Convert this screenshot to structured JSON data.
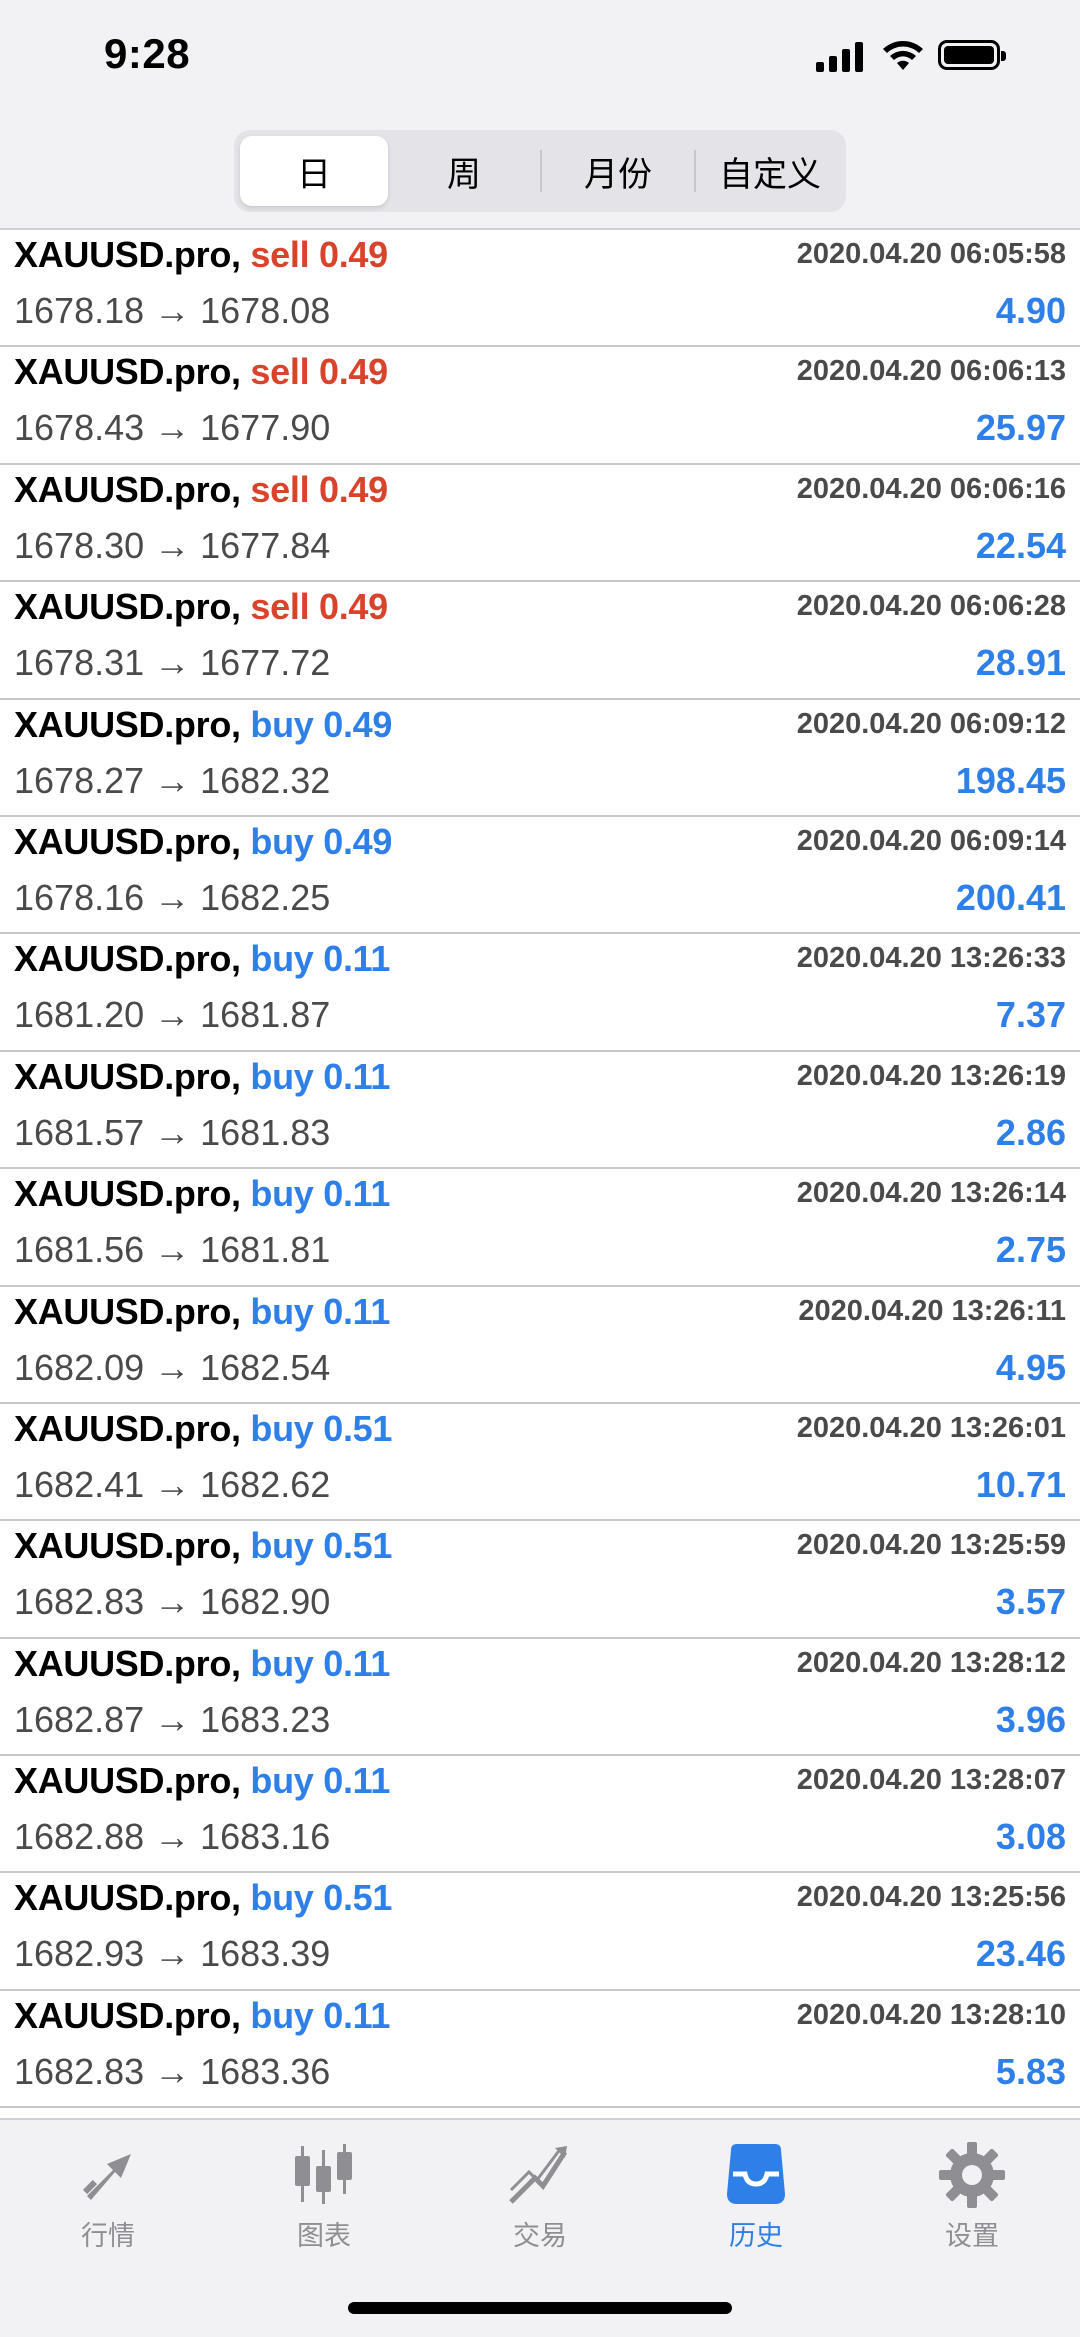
{
  "status_bar": {
    "time": "9:28"
  },
  "segmented": [
    "日",
    "周",
    "月份",
    "自定义"
  ],
  "segmented_active": 0,
  "colors": {
    "sell": "#d9432c",
    "buy": "#2f7fe8",
    "profit": "#2f7fe8"
  },
  "trades": [
    {
      "symbol": "XAUUSD.pro,",
      "side": "sell",
      "volume": "0.49",
      "time": "2020.04.20 06:05:58",
      "prices": "1678.18 → 1678.08",
      "profit": "4.90"
    },
    {
      "symbol": "XAUUSD.pro,",
      "side": "sell",
      "volume": "0.49",
      "time": "2020.04.20 06:06:13",
      "prices": "1678.43 → 1677.90",
      "profit": "25.97"
    },
    {
      "symbol": "XAUUSD.pro,",
      "side": "sell",
      "volume": "0.49",
      "time": "2020.04.20 06:06:16",
      "prices": "1678.30 → 1677.84",
      "profit": "22.54"
    },
    {
      "symbol": "XAUUSD.pro,",
      "side": "sell",
      "volume": "0.49",
      "time": "2020.04.20 06:06:28",
      "prices": "1678.31 → 1677.72",
      "profit": "28.91"
    },
    {
      "symbol": "XAUUSD.pro,",
      "side": "buy",
      "volume": "0.49",
      "time": "2020.04.20 06:09:12",
      "prices": "1678.27 → 1682.32",
      "profit": "198.45"
    },
    {
      "symbol": "XAUUSD.pro,",
      "side": "buy",
      "volume": "0.49",
      "time": "2020.04.20 06:09:14",
      "prices": "1678.16 → 1682.25",
      "profit": "200.41"
    },
    {
      "symbol": "XAUUSD.pro,",
      "side": "buy",
      "volume": "0.11",
      "time": "2020.04.20 13:26:33",
      "prices": "1681.20 → 1681.87",
      "profit": "7.37"
    },
    {
      "symbol": "XAUUSD.pro,",
      "side": "buy",
      "volume": "0.11",
      "time": "2020.04.20 13:26:19",
      "prices": "1681.57 → 1681.83",
      "profit": "2.86"
    },
    {
      "symbol": "XAUUSD.pro,",
      "side": "buy",
      "volume": "0.11",
      "time": "2020.04.20 13:26:14",
      "prices": "1681.56 → 1681.81",
      "profit": "2.75"
    },
    {
      "symbol": "XAUUSD.pro,",
      "side": "buy",
      "volume": "0.11",
      "time": "2020.04.20 13:26:11",
      "prices": "1682.09 → 1682.54",
      "profit": "4.95"
    },
    {
      "symbol": "XAUUSD.pro,",
      "side": "buy",
      "volume": "0.51",
      "time": "2020.04.20 13:26:01",
      "prices": "1682.41 → 1682.62",
      "profit": "10.71"
    },
    {
      "symbol": "XAUUSD.pro,",
      "side": "buy",
      "volume": "0.51",
      "time": "2020.04.20 13:25:59",
      "prices": "1682.83 → 1682.90",
      "profit": "3.57"
    },
    {
      "symbol": "XAUUSD.pro,",
      "side": "buy",
      "volume": "0.11",
      "time": "2020.04.20 13:28:12",
      "prices": "1682.87 → 1683.23",
      "profit": "3.96"
    },
    {
      "symbol": "XAUUSD.pro,",
      "side": "buy",
      "volume": "0.11",
      "time": "2020.04.20 13:28:07",
      "prices": "1682.88 → 1683.16",
      "profit": "3.08"
    },
    {
      "symbol": "XAUUSD.pro,",
      "side": "buy",
      "volume": "0.51",
      "time": "2020.04.20 13:25:56",
      "prices": "1682.93 → 1683.39",
      "profit": "23.46"
    },
    {
      "symbol": "XAUUSD.pro,",
      "side": "buy",
      "volume": "0.11",
      "time": "2020.04.20 13:28:10",
      "prices": "1682.83 → 1683.36",
      "profit": "5.83"
    }
  ],
  "tabs": [
    {
      "label": "行情",
      "icon": "quotes-arrows-icon"
    },
    {
      "label": "图表",
      "icon": "candlestick-chart-icon"
    },
    {
      "label": "交易",
      "icon": "trade-chart-icon"
    },
    {
      "label": "历史",
      "icon": "inbox-history-icon"
    },
    {
      "label": "设置",
      "icon": "gear-icon"
    }
  ],
  "tabs_active": 3
}
